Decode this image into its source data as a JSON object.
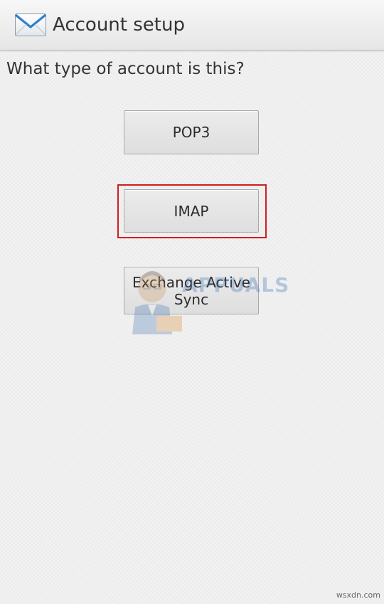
{
  "header": {
    "icon": "envelope-icon",
    "title": "Account setup"
  },
  "prompt": {
    "text": "What type of account is this?"
  },
  "options": [
    {
      "label": "POP3"
    },
    {
      "label": "IMAP",
      "highlighted": true
    },
    {
      "label": "Exchange Active Sync"
    }
  ],
  "watermark": {
    "text": "APPUALS"
  },
  "footer": {
    "text": "wsxdn.com"
  },
  "colors": {
    "highlight": "#d01e1e",
    "envelope": "#2f7fce"
  }
}
